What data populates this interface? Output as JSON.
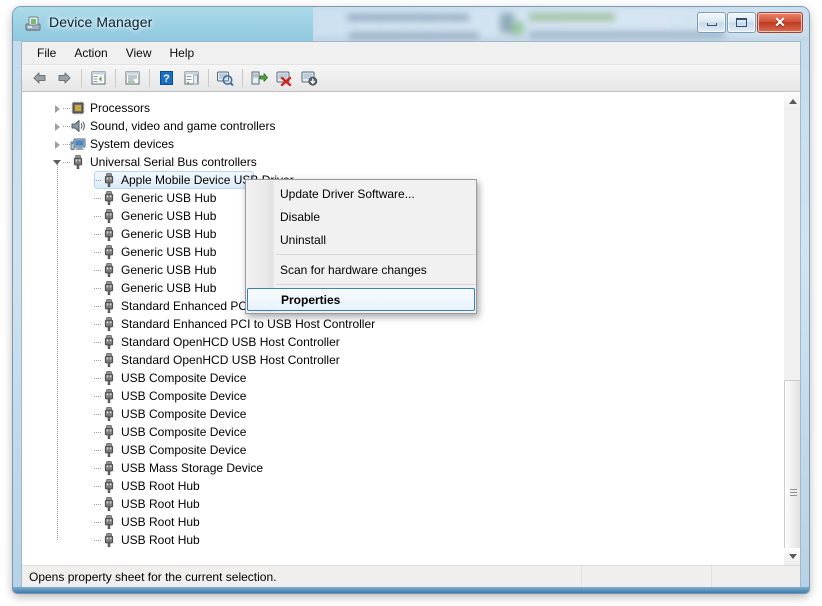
{
  "window": {
    "title": "Device Manager",
    "title_icon": "device-manager-icon",
    "buttons": {
      "minimize": "Minimize",
      "maximize": "Maximize",
      "close": "Close"
    }
  },
  "menubar": {
    "items": [
      {
        "label": "File"
      },
      {
        "label": "Action"
      },
      {
        "label": "View"
      },
      {
        "label": "Help"
      }
    ]
  },
  "toolbar": {
    "buttons": [
      {
        "name": "back-icon",
        "title": "Back"
      },
      {
        "name": "forward-icon",
        "title": "Forward"
      },
      {
        "name": "show-hide-console-tree-icon",
        "title": "Show/Hide Console Tree"
      },
      {
        "name": "properties-icon",
        "title": "Properties"
      },
      {
        "name": "help-icon",
        "title": "Help"
      },
      {
        "name": "show-hide-action-pane-icon",
        "title": "Show/Hide Action Pane"
      },
      {
        "name": "scan-for-hardware-changes-icon",
        "title": "Scan for hardware changes"
      },
      {
        "name": "update-driver-software-icon",
        "title": "Update Driver Software"
      },
      {
        "name": "uninstall-device-icon",
        "title": "Uninstall"
      },
      {
        "name": "disable-device-icon",
        "title": "Disable"
      }
    ]
  },
  "tree": {
    "nodes": [
      {
        "label": "Processors",
        "icon": "processor-icon",
        "depth": 1,
        "state": "collapsed",
        "selected": false
      },
      {
        "label": "Sound, video and game controllers",
        "icon": "sound-icon",
        "depth": 1,
        "state": "collapsed",
        "selected": false
      },
      {
        "label": "System devices",
        "icon": "system-device-icon",
        "depth": 1,
        "state": "collapsed",
        "selected": false
      },
      {
        "label": "Universal Serial Bus controllers",
        "icon": "usb-icon",
        "depth": 1,
        "state": "expanded",
        "selected": false
      },
      {
        "label": "Apple Mobile Device USB Driver",
        "icon": "usb-icon",
        "depth": 2,
        "state": "leaf",
        "selected": true
      },
      {
        "label": "Generic USB Hub",
        "icon": "usb-icon",
        "depth": 2,
        "state": "leaf",
        "selected": false
      },
      {
        "label": "Generic USB Hub",
        "icon": "usb-icon",
        "depth": 2,
        "state": "leaf",
        "selected": false
      },
      {
        "label": "Generic USB Hub",
        "icon": "usb-icon",
        "depth": 2,
        "state": "leaf",
        "selected": false
      },
      {
        "label": "Generic USB Hub",
        "icon": "usb-icon",
        "depth": 2,
        "state": "leaf",
        "selected": false
      },
      {
        "label": "Generic USB Hub",
        "icon": "usb-icon",
        "depth": 2,
        "state": "leaf",
        "selected": false
      },
      {
        "label": "Generic USB Hub",
        "icon": "usb-icon",
        "depth": 2,
        "state": "leaf",
        "selected": false
      },
      {
        "label": "Standard Enhanced PCI to USB Host Controller",
        "icon": "usb-icon",
        "depth": 2,
        "state": "leaf",
        "selected": false
      },
      {
        "label": "Standard Enhanced PCI to USB Host Controller",
        "icon": "usb-icon",
        "depth": 2,
        "state": "leaf",
        "selected": false
      },
      {
        "label": "Standard OpenHCD USB Host Controller",
        "icon": "usb-icon",
        "depth": 2,
        "state": "leaf",
        "selected": false
      },
      {
        "label": "Standard OpenHCD USB Host Controller",
        "icon": "usb-icon",
        "depth": 2,
        "state": "leaf",
        "selected": false
      },
      {
        "label": "USB Composite Device",
        "icon": "usb-icon",
        "depth": 2,
        "state": "leaf",
        "selected": false
      },
      {
        "label": "USB Composite Device",
        "icon": "usb-icon",
        "depth": 2,
        "state": "leaf",
        "selected": false
      },
      {
        "label": "USB Composite Device",
        "icon": "usb-icon",
        "depth": 2,
        "state": "leaf",
        "selected": false
      },
      {
        "label": "USB Composite Device",
        "icon": "usb-icon",
        "depth": 2,
        "state": "leaf",
        "selected": false
      },
      {
        "label": "USB Composite Device",
        "icon": "usb-icon",
        "depth": 2,
        "state": "leaf",
        "selected": false
      },
      {
        "label": "USB Mass Storage Device",
        "icon": "usb-icon",
        "depth": 2,
        "state": "leaf",
        "selected": false
      },
      {
        "label": "USB Root Hub",
        "icon": "usb-icon",
        "depth": 2,
        "state": "leaf",
        "selected": false
      },
      {
        "label": "USB Root Hub",
        "icon": "usb-icon",
        "depth": 2,
        "state": "leaf",
        "selected": false
      },
      {
        "label": "USB Root Hub",
        "icon": "usb-icon",
        "depth": 2,
        "state": "leaf",
        "selected": false
      },
      {
        "label": "USB Root Hub",
        "icon": "usb-icon",
        "depth": 2,
        "state": "leaf",
        "selected": false
      }
    ]
  },
  "context_menu": {
    "items": [
      {
        "label": "Update Driver Software...",
        "bold": false,
        "highlighted": false,
        "separator_after": false
      },
      {
        "label": "Disable",
        "bold": false,
        "highlighted": false,
        "separator_after": false
      },
      {
        "label": "Uninstall",
        "bold": false,
        "highlighted": false,
        "separator_after": true
      },
      {
        "label": "Scan for hardware changes",
        "bold": false,
        "highlighted": false,
        "separator_after": true
      },
      {
        "label": "Properties",
        "bold": true,
        "highlighted": true,
        "separator_after": false
      }
    ]
  },
  "statusbar": {
    "message": "Opens property sheet for the current selection."
  },
  "colors": {
    "accent": "#3c7fb1",
    "titlebar_glass": "#96d0e2",
    "selection_border": "#b8d6f0",
    "close_button": "#d3543a"
  }
}
